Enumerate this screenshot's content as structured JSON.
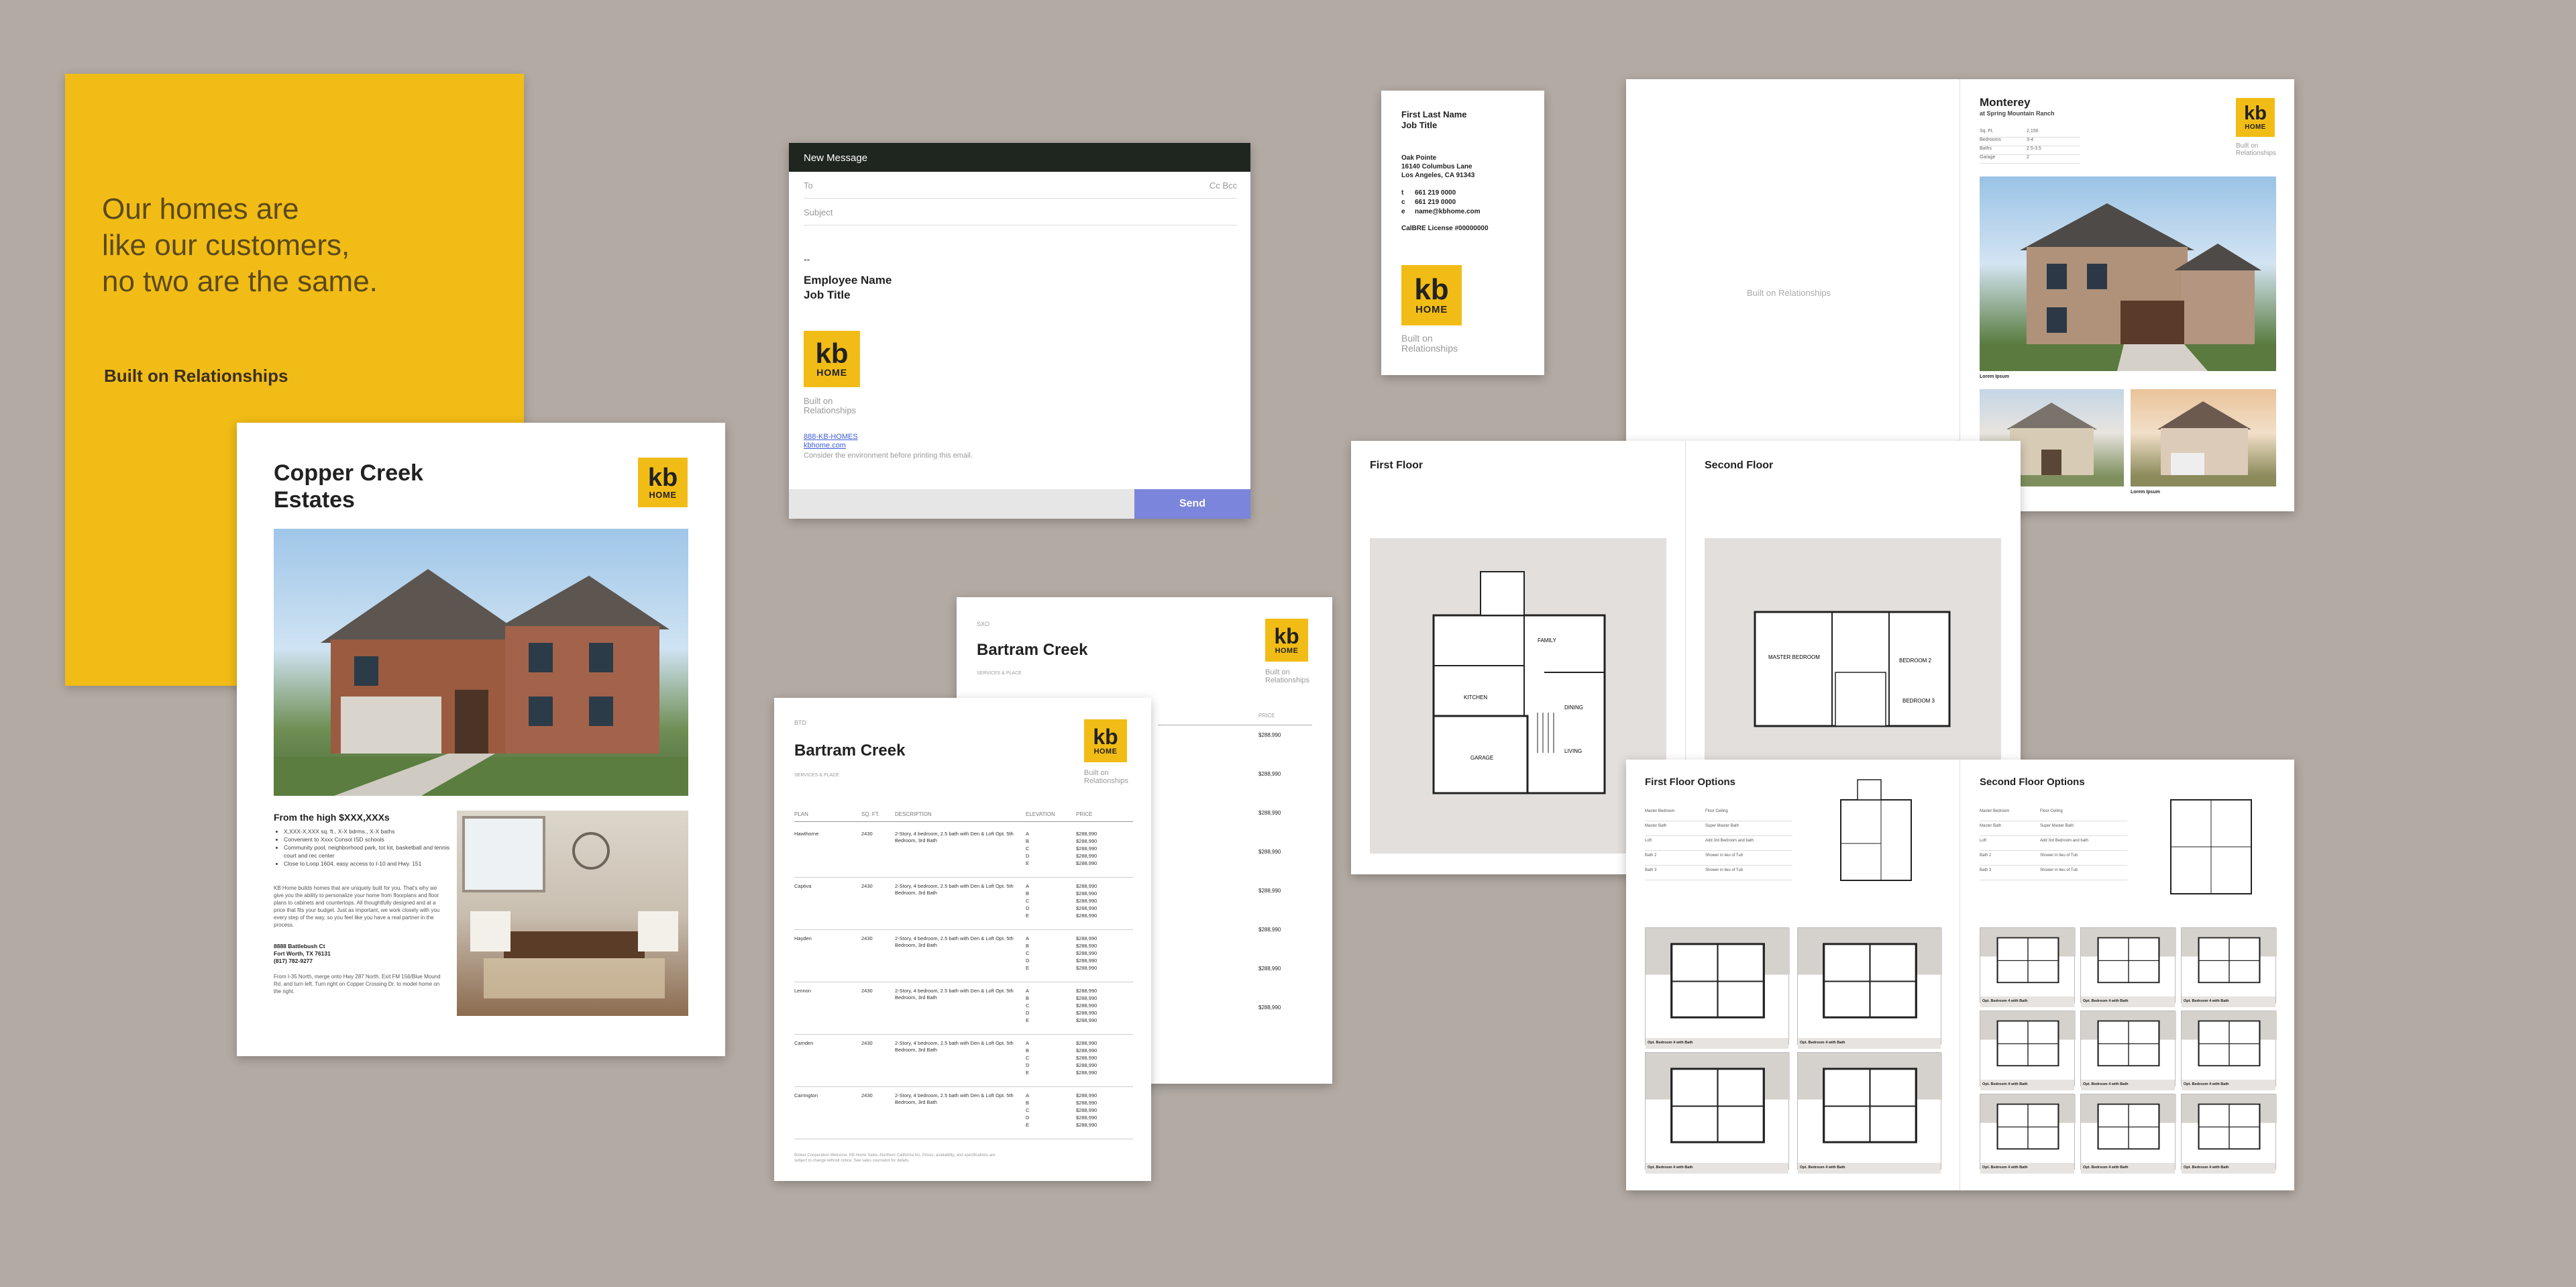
{
  "colors": {
    "background": "#b3aaa3",
    "brand_yellow": "#f2bc16",
    "send_button": "#7b85db",
    "email_header": "#1f2620"
  },
  "logo": {
    "kb": "kb",
    "home": "HOME"
  },
  "tagline": "Built on Relationships",
  "yellow_card": {
    "headline": [
      "Our homes are",
      "like our customers,",
      "no two are the same."
    ],
    "signature": "Built on Relationships"
  },
  "brochure": {
    "title_lines": [
      "Copper Creek",
      "Estates"
    ],
    "price": "From the high $XXX,XXXs",
    "bullets": [
      "X,XXX-X,XXX sq. ft., X-X bdrms., X-X baths",
      "Convenient to Xxxx Consol ISD schools",
      "Community pool, neighborhood park, tot lot, basketball and tennis court and rec center",
      "Close to Loop 1604, easy access to I-10 and Hwy. 151"
    ],
    "body": "KB Home builds homes that are uniquely built for you. That's why we give you the ability to personalize your home from floorplans and floor plans to cabinets and countertops. All thoughtfully designed and at a price that fits your budget. Just as important, we work closely with you every step of the way, so you feel like you have a real partner in the process.",
    "address": [
      "8888 Battlebush Ct",
      "Fort Worth, TX 76131",
      "(817) 782-9277"
    ],
    "directions": "From I-35 North, merge onto Hwy 287 North. Exit FM 156/Blue Mound Rd. and turn left. Turn right on Copper Crossing Dr. to model home on the right."
  },
  "email": {
    "header": "New Message",
    "to": "To",
    "cc": "Cc Bcc",
    "subject": "Subject",
    "dash": "--",
    "name": "Employee Name",
    "title": "Job Title",
    "phone": "888-KB-HOMES",
    "site": "kbhome.com",
    "note": "Consider the environment before printing this email.",
    "send": "Send"
  },
  "business_card": {
    "name": "First Last Name",
    "title": "Job Title",
    "office": "Oak Pointe",
    "street": "16140 Columbus Lane",
    "city": "Los Angeles, CA 91343",
    "t_label": "t",
    "t": "661 219 0000",
    "c_label": "c",
    "c": "661 219 0000",
    "e_label": "e",
    "e": "name@kbhome.com",
    "license": "CalBRE License #00000000"
  },
  "monterey": {
    "left_tag": "Built on Relationships",
    "title": "Monterey",
    "subtitle": "at Spring Mountain Ranch",
    "specs": [
      {
        "k": "Sq. Ft.",
        "v": "2,150"
      },
      {
        "k": "Bedrooms",
        "v": "3-4"
      },
      {
        "k": "Baths",
        "v": "2.5-3.5"
      },
      {
        "k": "Garage",
        "v": "2"
      }
    ],
    "captions": [
      "Lorem Ipsum",
      "Lorem Ipsum",
      "Lorem Ipsum"
    ]
  },
  "floors": {
    "first": "First Floor",
    "second": "Second Floor",
    "rooms_first": [
      "FAMILY",
      "KITCHEN",
      "DINING",
      "LIVING",
      "GARAGE"
    ],
    "rooms_second": [
      "MASTER BEDROOM",
      "BEDROOM 2",
      "BEDROOM 3"
    ]
  },
  "options": {
    "first": "First Floor Options",
    "second": "Second Floor Options",
    "rows": [
      {
        "k": "Master Bedroom",
        "v": "Floor Ceiling"
      },
      {
        "k": "Master Bath",
        "v": "Super Master Bath"
      },
      {
        "k": "Loft",
        "v": "Add 3rd Bedroom and bath"
      },
      {
        "k": "Bath 2",
        "v": "Shower in lieu of Tub"
      },
      {
        "k": "Bath 3",
        "v": "Shower in lieu of Tub"
      }
    ],
    "first_captions": [
      "Opt. Bedroom 4 with Bath",
      "Opt. Bedroom 4 with Bath",
      "Opt. Bedroom 4 with Bath",
      "Opt. Bedroom 4 with Bath"
    ],
    "second_captions": [
      "Opt. Bedroom 4 with Bath",
      "Opt. Bedroom 4 with Bath",
      "Opt. Bedroom 4 with Bath",
      "Opt. Bedroom 4 with Bath",
      "Opt. Bedroom 4 with Bath",
      "Opt. Bedroom 4 with Bath",
      "Opt. Bedroom 4 with Bath",
      "Opt. Bedroom 4 with Bath",
      "Opt. Bedroom 4 with Bath"
    ]
  },
  "pricesheet": {
    "code": "BTD",
    "title": "Bartram Creek",
    "sub": "SERVICES & PLACE",
    "cols": [
      "PLAN",
      "SQ. FT.",
      "DESCRIPTION",
      "ELEVATION",
      "PRICE"
    ],
    "plans": [
      {
        "plan": "Hawthorne",
        "sqft": "2430",
        "desc": "2-Story, 4 bedroom, 2.5 bath with Den & Loft Opt. 5th Bedroom, 3rd Bath",
        "elev": [
          "A",
          "B",
          "C",
          "D",
          "E"
        ],
        "price": [
          "$288,990",
          "$288,990",
          "$288,990",
          "$288,990",
          "$288,990"
        ]
      },
      {
        "plan": "Captiva",
        "sqft": "2430",
        "desc": "2-Story, 4 bedroom, 2.5 bath with Den & Loft Opt. 5th Bedroom, 3rd Bath",
        "elev": [
          "A",
          "B",
          "C",
          "D",
          "E"
        ],
        "price": [
          "$288,990",
          "$288,990",
          "$288,990",
          "$288,990",
          "$288,990"
        ]
      },
      {
        "plan": "Hayden",
        "sqft": "2430",
        "desc": "2-Story, 4 bedroom, 2.5 bath with Den & Loft Opt. 5th Bedroom, 3rd Bath",
        "elev": [
          "A",
          "B",
          "C",
          "D",
          "E"
        ],
        "price": [
          "$288,990",
          "$288,990",
          "$288,990",
          "$288,990",
          "$288,990"
        ]
      },
      {
        "plan": "Lennon",
        "sqft": "2430",
        "desc": "2-Story, 4 bedroom, 2.5 bath with Den & Loft Opt. 5th Bedroom, 3rd Bath",
        "elev": [
          "A",
          "B",
          "C",
          "D",
          "E"
        ],
        "price": [
          "$288,990",
          "$288,990",
          "$288,990",
          "$288,990",
          "$288,990"
        ]
      },
      {
        "plan": "Camden",
        "sqft": "2430",
        "desc": "2-Story, 4 bedroom, 2.5 bath with Den & Loft Opt. 5th Bedroom, 3rd Bath",
        "elev": [
          "A",
          "B",
          "C",
          "D",
          "E"
        ],
        "price": [
          "$288,990",
          "$288,990",
          "$288,990",
          "$288,990",
          "$288,990"
        ]
      },
      {
        "plan": "Carrington",
        "sqft": "2430",
        "desc": "2-Story, 4 bedroom, 2.5 bath with Den & Loft Opt. 5th Bedroom, 3rd Bath",
        "elev": [
          "A",
          "B",
          "C",
          "D",
          "E"
        ],
        "price": [
          "$288,990",
          "$288,990",
          "$288,990",
          "$288,990",
          "$288,990"
        ]
      }
    ],
    "footer": "Broker Cooperation Welcome. KB Home Sales–Northern California Inc. Prices, availability, and specifications are subject to change without notice. See sales counselor for details.",
    "back_code": "SXO",
    "back_col": "PRICE",
    "back_price": "$288,990"
  }
}
